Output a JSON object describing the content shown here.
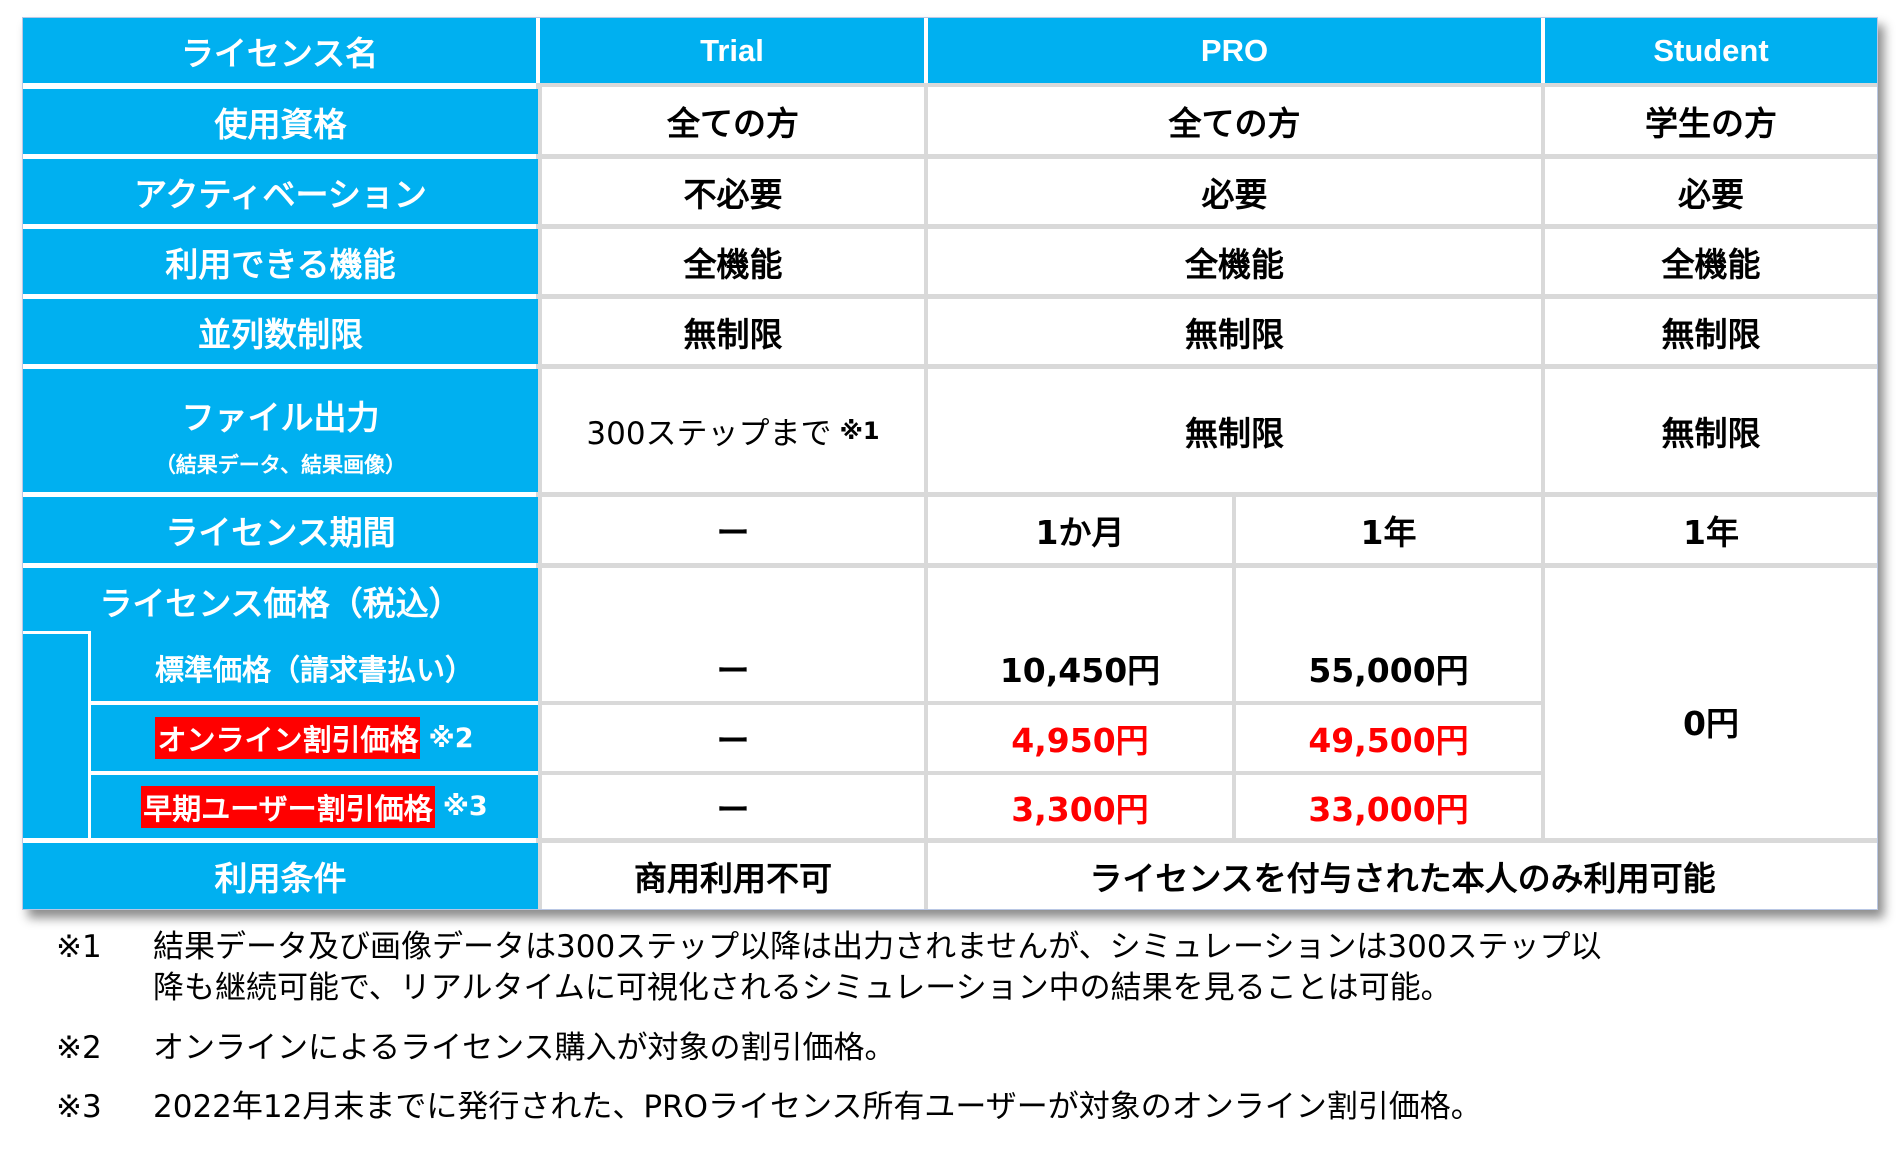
{
  "table": {
    "header": {
      "row_label": "ライセンス名",
      "trial": "Trial",
      "pro": "PRO",
      "student": "Student"
    },
    "rows": {
      "eligibility": {
        "label": "使用資格",
        "trial": "全ての方",
        "pro": "全ての方",
        "student": "学生の方"
      },
      "activation": {
        "label": "アクティベーション",
        "trial": "不必要",
        "pro": "必要",
        "student": "必要"
      },
      "features": {
        "label": "利用できる機能",
        "trial": "全機能",
        "pro": "全機能",
        "student": "全機能"
      },
      "parallel": {
        "label": "並列数制限",
        "trial": "無制限",
        "pro": "無制限",
        "student": "無制限"
      },
      "file_output": {
        "label": "ファイル出力",
        "sublabel": "（結果データ、結果画像）",
        "trial": "300ステップまで",
        "trial_note": "※1",
        "pro": "無制限",
        "student": "無制限"
      },
      "period": {
        "label": "ライセンス期間",
        "trial": "ー",
        "pro_month": "1か月",
        "pro_year": "1年",
        "student": "1年"
      },
      "price_header": {
        "label": "ライセンス価格（税込）"
      },
      "price_standard": {
        "label": "標準価格（請求書払い）",
        "trial": "ー",
        "pro_month": "10,450円",
        "pro_year": "55,000円"
      },
      "price_online": {
        "label": "オンライン割引価格",
        "note": "※2",
        "trial": "ー",
        "pro_month": "4,950円",
        "pro_year": "49,500円"
      },
      "price_early": {
        "label": "早期ユーザー割引価格",
        "note": "※3",
        "trial": "ー",
        "pro_month": "3,300円",
        "pro_year": "33,000円"
      },
      "price_student": "0円",
      "terms": {
        "label": "利用条件",
        "trial": "商用利用不可",
        "pro_student": "ライセンスを付与された本人のみ利用可能"
      }
    }
  },
  "footnotes": [
    {
      "mark": "※1",
      "line1": "結果データ及び画像データは300ステップ以降は出力されませんが、シミュレーションは300ステップ以",
      "line2": "降も継続可能で、リアルタイムに可視化されるシミュレーション中の結果を見ることは可能。"
    },
    {
      "mark": "※2",
      "line1": "オンラインによるライセンス購入が対象の割引価格。"
    },
    {
      "mark": "※3",
      "line1": "2022年12月末までに発行された、PROライセンス所有ユーザーが対象のオンライン割引価格。"
    }
  ],
  "colors": {
    "header_blue": "#00b0f0",
    "discount_red": "#ff0000",
    "grid_gray": "#d9d9d9"
  }
}
